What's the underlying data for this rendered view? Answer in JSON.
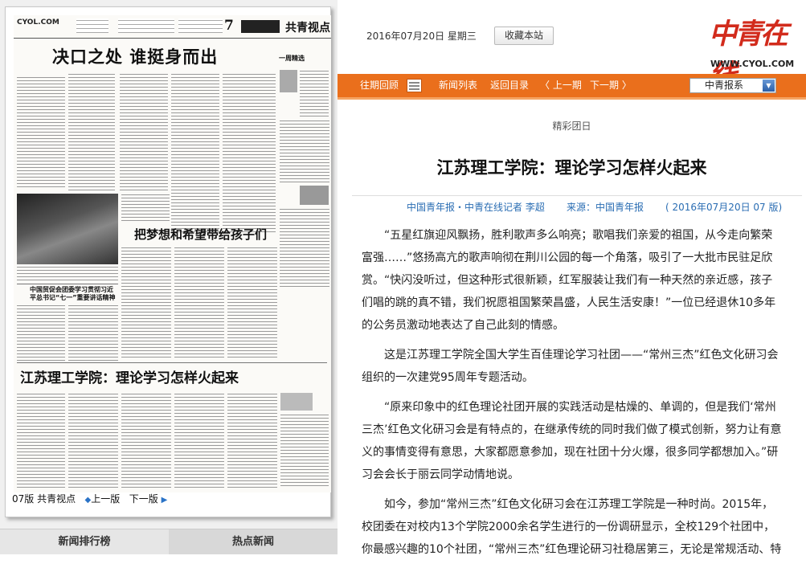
{
  "newspaper": {
    "page_number": "7",
    "section": "共青视点",
    "headline_main": "决口之处 谁挺身而出",
    "headline_2": "把梦想和希望带给孩子们",
    "headline_3": "中国贸促会团委学习贯彻习近平总书记“七一”重要讲话精神",
    "headline_4": "江苏理工学院：理论学习怎样火起来",
    "week_tag": "一周精选",
    "site_small": "CYOL.COM"
  },
  "page_label": {
    "text": "07版 共青视点",
    "prev": "上一版",
    "next": "下一版"
  },
  "bottom_tabs": [
    "新闻排行榜",
    "热点新闻"
  ],
  "header": {
    "date": "2016年07月20日  星期三",
    "favorite_btn": "收藏本站",
    "logo_text": "中青在线",
    "logo_url": "WWW.CYOL.COM"
  },
  "nav": {
    "items": [
      "往期回顾",
      "新闻列表",
      "返回目录",
      "上一期",
      "下一期"
    ],
    "select_value": "中青报系"
  },
  "article": {
    "column": "精彩团日",
    "title": "江苏理工学院：理论学习怎样火起来",
    "source_line": "中国青年报・中青在线记者  李超",
    "source_label": "来源：中国青年报",
    "date_page": "(  2016年07月20日    07 版)",
    "paragraphs": [
      "“五星红旗迎风飘扬，胜利歌声多么响亮；歌唱我们亲爱的祖国，从今走向繁荣富强……”悠扬高亢的歌声响彻在荆川公园的每一个角落，吸引了一大批市民驻足欣赏。“快闪没听过，但这种形式很新颖，红军服装让我们有一种天然的亲近感，孩子们唱的跳的真不错，我们祝愿祖国繁荣昌盛，人民生活安康！”一位已经退休10多年的公务员激动地表达了自己此刻的情感。",
      "这是江苏理工学院全国大学生百佳理论学习社团——“常州三杰”红色文化研习会组织的一次建党95周年专题活动。",
      "“原来印象中的红色理论社团开展的实践活动是枯燥的、单调的，但是我们‘常州三杰’红色文化研习会是有特点的，在继承传统的同时我们做了模式创新，努力让有意义的事情变得有意思，大家都愿意参加，现在社团十分火爆，很多同学都想加入。”研习会会长于丽云同学动情地说。",
      "如今，参加“常州三杰”红色文化研习会在江苏理工学院是一种时尚。2015年，校团委在对校内13个学院2000余名学生进行的一份调研显示，全校129个社团中，你最感兴趣的10个社团，“常州三杰”红色理论研习社稳居第三，无论是常规活动、特"
    ]
  },
  "colors": {
    "nav_orange": "#ea6f1c",
    "logo_red": "#d22b1c",
    "link_blue": "#2a6db3"
  }
}
